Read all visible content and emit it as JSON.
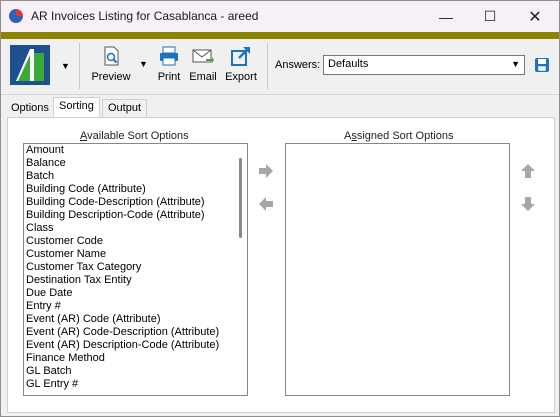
{
  "window": {
    "title": "AR Invoices Listing for Casablanca - areed",
    "minimize_glyph": "—",
    "maximize_glyph": "☐",
    "close_glyph": "✕"
  },
  "colors": {
    "accent_bar": "#8a8400",
    "icon_blue": "#1e73be",
    "logo_green": "#3aa935"
  },
  "toolbar": {
    "preview_label": "Preview",
    "print_label": "Print",
    "email_label": "Email",
    "export_label": "Export",
    "answers_label": "Answers:",
    "answers_value": "Defaults"
  },
  "tabs": [
    {
      "label": "Options"
    },
    {
      "label": "Sorting"
    },
    {
      "label": "Output"
    }
  ],
  "sorting": {
    "available_title_accel": "A",
    "available_title_rest": "vailable Sort Options",
    "assigned_title_pre": "A",
    "assigned_title_accel": "s",
    "assigned_title_rest": "signed Sort Options",
    "available_items": [
      "Amount",
      "Balance",
      "Batch",
      "Building Code (Attribute)",
      "Building Code-Description (Attribute)",
      "Building Description-Code (Attribute)",
      "Class",
      "Customer Code",
      "Customer Name",
      "Customer Tax Category",
      "Destination Tax Entity",
      "Due Date",
      "Entry #",
      "Event (AR) Code (Attribute)",
      "Event (AR) Code-Description (Attribute)",
      "Event (AR) Description-Code (Attribute)",
      "Finance Method",
      "GL Batch",
      "GL Entry #"
    ],
    "assigned_items": []
  }
}
